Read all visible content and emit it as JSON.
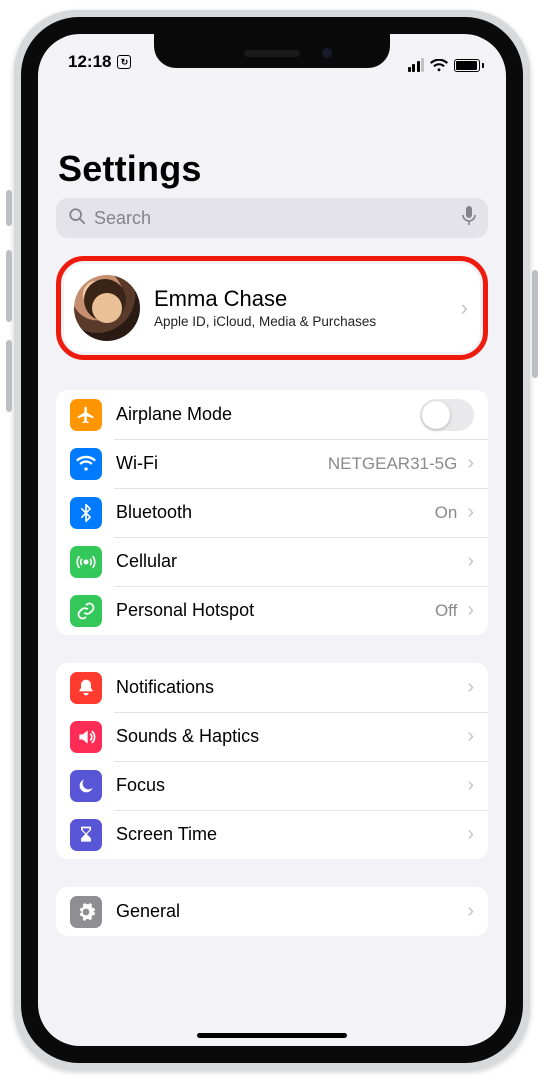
{
  "status": {
    "time": "12:18",
    "cellular_bars": 3,
    "wifi": true,
    "battery_full": true
  },
  "page": {
    "title": "Settings"
  },
  "search": {
    "placeholder": "Search"
  },
  "profile": {
    "name": "Emma Chase",
    "subtitle": "Apple ID, iCloud, Media & Purchases"
  },
  "groups": [
    {
      "rows": [
        {
          "icon": "airplane",
          "color": "orange",
          "label": "Airplane Mode",
          "control": "toggle",
          "toggle_on": false
        },
        {
          "icon": "wifi",
          "color": "blue",
          "label": "Wi-Fi",
          "value": "NETGEAR31-5G",
          "control": "chevron"
        },
        {
          "icon": "bluetooth",
          "color": "blue",
          "label": "Bluetooth",
          "value": "On",
          "control": "chevron"
        },
        {
          "icon": "cellular",
          "color": "green",
          "label": "Cellular",
          "control": "chevron"
        },
        {
          "icon": "hotspot",
          "color": "green",
          "label": "Personal Hotspot",
          "value": "Off",
          "control": "chevron"
        }
      ]
    },
    {
      "rows": [
        {
          "icon": "notifications",
          "color": "red",
          "label": "Notifications",
          "control": "chevron"
        },
        {
          "icon": "sounds",
          "color": "pink",
          "label": "Sounds & Haptics",
          "control": "chevron"
        },
        {
          "icon": "focus",
          "color": "indigo",
          "label": "Focus",
          "control": "chevron"
        },
        {
          "icon": "screentime",
          "color": "indigo",
          "label": "Screen Time",
          "control": "chevron"
        }
      ]
    },
    {
      "rows": [
        {
          "icon": "general",
          "color": "gray",
          "label": "General",
          "control": "chevron"
        }
      ]
    }
  ]
}
